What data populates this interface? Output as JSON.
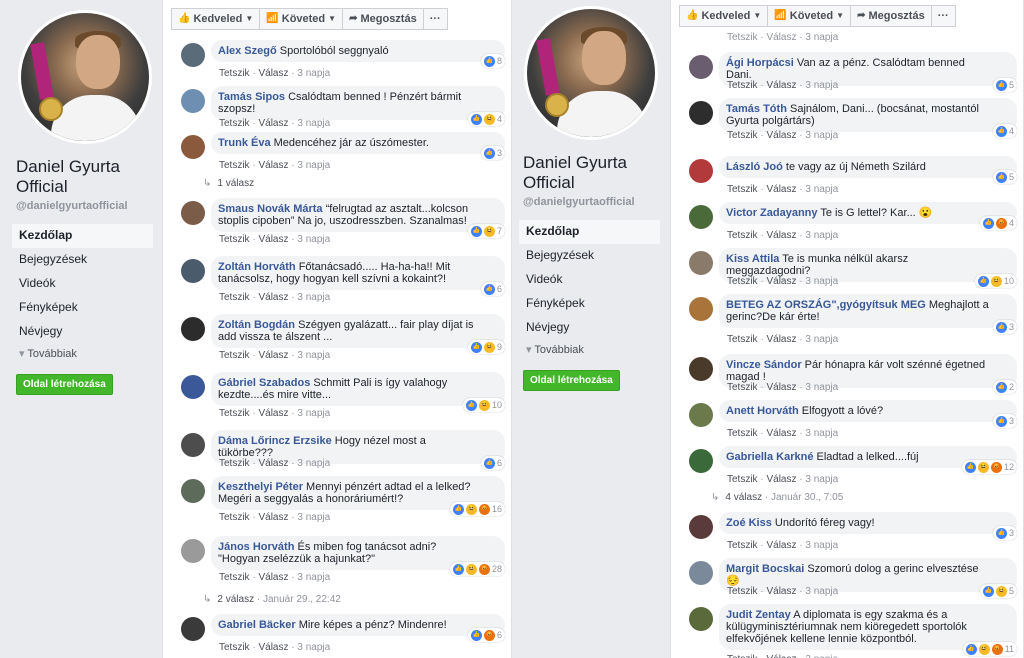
{
  "page": {
    "name_line1": "Daniel Gyurta",
    "name_line2": "Official",
    "handle": "@danielgyurtaofficial",
    "nav": [
      "Kezdőlap",
      "Bejegyzések",
      "Videók",
      "Fényképek",
      "Névjegy"
    ],
    "more_label": "Továbbiak",
    "create_page_label": "Oldal létrehozása"
  },
  "actions": {
    "like": "Kedveled",
    "follow": "Követed",
    "share": "Megosztás",
    "more": "···"
  },
  "meta": {
    "like": "Tetszik",
    "reply": "Válasz",
    "sep": "·"
  },
  "left_comments": [
    {
      "author": "Alex Szegő",
      "text": "Sportolóból seggnyaló",
      "time": "3 napja",
      "count": "8",
      "rx": [
        "like"
      ],
      "color": "#5a6b7a"
    },
    {
      "author": "Tamás Sipos",
      "text": "Csalódtam benned ! Pénzért bármit szopsz!",
      "time": "3 napja",
      "count": "4",
      "rx": [
        "like",
        "haha"
      ],
      "color": "#6f8fb2"
    },
    {
      "author": "Trunk Éva",
      "text": "Medencéhez jár az úszómester.",
      "time": "3 napja",
      "count": "3",
      "rx": [
        "like"
      ],
      "color": "#8b5a3c"
    },
    {
      "author": "Smaus Novák Márta",
      "text": "“felrugtad az asztalt...kolcson stoplis cipoben” Na jo, uszodresszben. Szanalmas!",
      "time": "3 napja",
      "count": "7",
      "rx": [
        "like",
        "haha"
      ],
      "color": "#7a5c48"
    },
    {
      "author": "Zoltán Horváth",
      "text": "Főtanácsadó..... Ha-ha-ha!! Mit tanácsolsz, hogy hogyan kell szívni a kokaint?!",
      "time": "3 napja",
      "count": "6",
      "rx": [
        "like"
      ],
      "color": "#4a5b6c"
    },
    {
      "author": "Zoltán Bogdán",
      "text": "Szégyen gyalázatt... fair play díjat is add vissza te álszent ...",
      "time": "3 napja",
      "count": "9",
      "rx": [
        "like",
        "haha"
      ],
      "color": "#2c2c2c"
    },
    {
      "author": "Gábriel Szabados",
      "text": "Schmitt Pali is így valahogy kezdte....és mire vitte...",
      "time": "3 napja",
      "count": "10",
      "rx": [
        "like",
        "haha"
      ],
      "color": "#3b5998"
    },
    {
      "author": "Dáma Lőrincz Erzsike",
      "text": "Hogy nézel most a tükörbe???",
      "time": "3 napja",
      "count": "6",
      "rx": [
        "like"
      ],
      "color": "#4d4d4d"
    },
    {
      "author": "Keszthelyi Péter",
      "text": "Mennyi pénzért adtad el a lelked? Megéri a seggyalás a honoráriumért!?",
      "time": "3 napja",
      "count": "16",
      "rx": [
        "like",
        "haha",
        "angry"
      ],
      "color": "#5c6b5a"
    },
    {
      "author": "János Horváth",
      "text": "És miben fog tanácsot adni? \"Hogyan zselézzük a hajunkat?\"",
      "time": "3 napja",
      "count": "28",
      "rx": [
        "like",
        "haha",
        "angry"
      ],
      "color": "#9a9a9a"
    },
    {
      "author": "Gabriel Bäcker",
      "text": "Mire képes a pénz? Mindenre!",
      "time": "3 napja",
      "count": "6",
      "rx": [
        "like",
        "angry"
      ],
      "color": "#3a3a3a"
    }
  ],
  "left_replies": [
    {
      "label": "1 válasz",
      "date": ""
    },
    {
      "label": "2 válasz",
      "date": "Január 29., 22:42"
    }
  ],
  "right_comments": [
    {
      "author": "Ági Horpácsi",
      "text": "Van az a pénz. Csalódtam benned Dani.",
      "time": "3 napja",
      "count": "5",
      "rx": [
        "like"
      ],
      "color": "#6b5d70"
    },
    {
      "author": "Tamás Tóth",
      "text": "Sajnálom, Dani... (bocsánat, mostantól Gyurta polgártárs)",
      "time": "3 napja",
      "count": "4",
      "rx": [
        "like"
      ],
      "color": "#2d2d2d"
    },
    {
      "author": "László Joó",
      "text": "te vagy az új Németh Szilárd",
      "time": "3 napja",
      "count": "5",
      "rx": [
        "like"
      ],
      "color": "#b23a3a"
    },
    {
      "author": "Victor Zadayanny",
      "text": "Te is G lettel? Kar... 😮",
      "time": "3 napja",
      "count": "4",
      "rx": [
        "like",
        "angry"
      ],
      "color": "#4a6a3a"
    },
    {
      "author": "Kiss Attila",
      "text": "Te is munka nélkül akarsz meggazdagodni?",
      "time": "3 napja",
      "count": "10",
      "rx": [
        "like",
        "haha"
      ],
      "color": "#8a7a6a"
    },
    {
      "author": "BETEG AZ ORSZÁG\",gyógyítsuk MEG",
      "text": "Meghajlott a gerinc?De kár érte!",
      "time": "3 napja",
      "count": "3",
      "rx": [
        "like"
      ],
      "color": "#a8743a"
    },
    {
      "author": "Vincze Sándor",
      "text": "Pár hónapra kár volt szénné égetned magad !",
      "time": "3 napja",
      "count": "2",
      "rx": [
        "like"
      ],
      "color": "#4a3a2a"
    },
    {
      "author": "Anett Horváth",
      "text": "Elfogyott a lóvé?",
      "time": "3 napja",
      "count": "3",
      "rx": [
        "like"
      ],
      "color": "#6a7a4a"
    },
    {
      "author": "Gabriella Karkné",
      "text": "Eladtad a lelked....fúj",
      "time": "3 napja",
      "count": "12",
      "rx": [
        "like",
        "haha",
        "angry"
      ],
      "color": "#3a6a3a"
    },
    {
      "author": "Zoé Kiss",
      "text": "Undorító féreg vagy!",
      "time": "3 napja",
      "count": "3",
      "rx": [
        "like"
      ],
      "color": "#5a3a3a"
    },
    {
      "author": "Margit Bocskai",
      "text": "Szomorú dolog a gerinc elvesztése 😔",
      "time": "3 napja",
      "count": "5",
      "rx": [
        "like",
        "haha"
      ],
      "color": "#7a8a9a"
    },
    {
      "author": "Judit Zentay",
      "text": "A diplomata is egy szakma és a külügyminisztériumnak nem kiöregedett sportolók elfekvőjének kellene lennie központból.",
      "time": "3 napja",
      "count": "11",
      "rx": [
        "like",
        "haha",
        "angry"
      ],
      "color": "#5a6a3a"
    }
  ],
  "right_replies": [
    {
      "label": "4 válasz",
      "date": "Január 30., 7:05"
    }
  ],
  "right_top_time": "3 napja"
}
